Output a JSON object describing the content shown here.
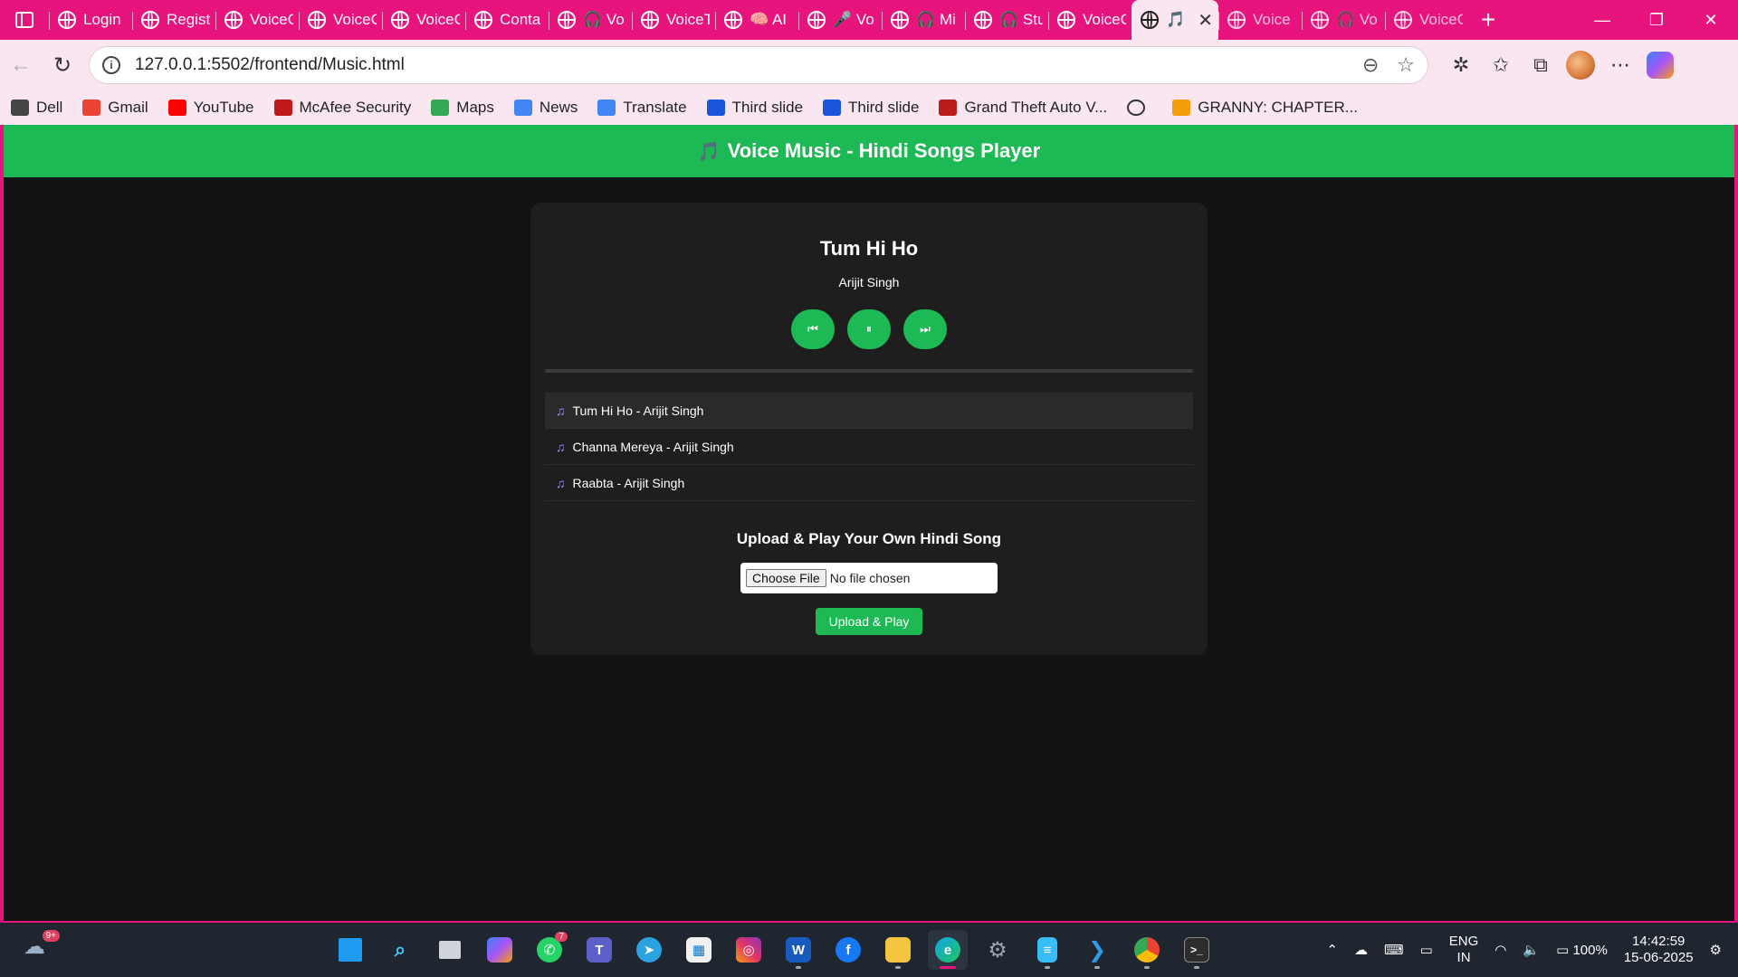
{
  "browser": {
    "tabs": [
      {
        "label": "Login",
        "icon": "globe"
      },
      {
        "label": "Registe",
        "icon": "globe"
      },
      {
        "label": "VoiceC",
        "icon": "globe"
      },
      {
        "label": "VoiceC",
        "icon": "globe"
      },
      {
        "label": "VoiceC",
        "icon": "globe"
      },
      {
        "label": "Conta",
        "icon": "globe"
      },
      {
        "label": "🎧 Vo",
        "icon": "globe"
      },
      {
        "label": "VoiceT",
        "icon": "globe"
      },
      {
        "label": "🧠 AI",
        "icon": "globe"
      },
      {
        "label": "🎤 Vo",
        "icon": "globe"
      },
      {
        "label": "🎧 Mi",
        "icon": "globe"
      },
      {
        "label": "🎧 Stu",
        "icon": "globe"
      },
      {
        "label": "VoiceC",
        "icon": "globe"
      },
      {
        "label": "🎵",
        "icon": "globe",
        "active": true
      },
      {
        "label": "Voice",
        "icon": "globe"
      },
      {
        "label": "🎧 Vo",
        "icon": "globe"
      },
      {
        "label": "VoiceC",
        "icon": "globe"
      }
    ],
    "new_tab": "+",
    "window_controls": {
      "minimize": "—",
      "restore": "❐",
      "close": "✕"
    },
    "url": "127.0.0.1:5502/frontend/Music.html",
    "bookmarks": [
      {
        "label": "Dell",
        "icon": "folder-icon",
        "color": "#444444"
      },
      {
        "label": "Gmail",
        "icon": "gmail-icon",
        "color": "#ea4335"
      },
      {
        "label": "YouTube",
        "icon": "youtube-icon",
        "color": "#ff0000"
      },
      {
        "label": "McAfee Security",
        "icon": "mcafee-icon",
        "color": "#c01818"
      },
      {
        "label": "Maps",
        "icon": "maps-icon",
        "color": "#34a853"
      },
      {
        "label": "News",
        "icon": "news-icon",
        "color": "#4285f4"
      },
      {
        "label": "Translate",
        "icon": "translate-icon",
        "color": "#4285f4"
      },
      {
        "label": "Third slide",
        "icon": "slide-icon",
        "color": "#1a56db"
      },
      {
        "label": "Third slide",
        "icon": "slide-icon",
        "color": "#1a56db"
      },
      {
        "label": "Grand Theft Auto V...",
        "icon": "gta-icon",
        "color": "#b91c1c"
      },
      {
        "label": "",
        "icon": "globe-icon",
        "color": "#333333"
      },
      {
        "label": "GRANNY: CHAPTER...",
        "icon": "crown-icon",
        "color": "#f59e0b"
      }
    ]
  },
  "app": {
    "header_icon": "🎵",
    "header_title": "Voice Music - Hindi Songs Player",
    "now_playing": {
      "title": "Tum Hi Ho",
      "artist": "Arijit Singh"
    },
    "controls": {
      "prev": "⏮",
      "pause": "⏸",
      "next": "⏭"
    },
    "progress": 0,
    "playlist": [
      {
        "label": "Tum Hi Ho - Arijit Singh",
        "active": true
      },
      {
        "label": "Channa Mereya - Arijit Singh"
      },
      {
        "label": "Raabta - Arijit Singh"
      }
    ],
    "upload": {
      "title": "Upload & Play Your Own Hindi Song",
      "choose_label": "Choose File",
      "file_status": "No file chosen",
      "button_label": "Upload & Play"
    },
    "colors": {
      "accent": "#1db954",
      "note": "#a78bfa",
      "background": "#121212",
      "card": "#1e1e1e"
    }
  },
  "taskbar": {
    "weather_badge": "9+",
    "whatsapp_badge": "7",
    "language": {
      "line1": "ENG",
      "line2": "IN"
    },
    "battery": "100%",
    "time": "14:42:59",
    "date": "15-06-2025"
  }
}
